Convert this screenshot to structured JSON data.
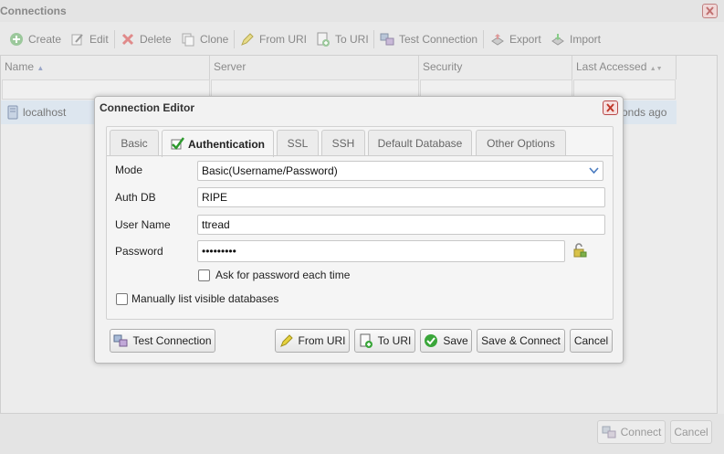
{
  "window": {
    "title": "Connections",
    "toolbar": {
      "create": "Create",
      "edit": "Edit",
      "delete": "Delete",
      "clone": "Clone",
      "from_uri": "From URI",
      "to_uri": "To URI",
      "test_connection": "Test Connection",
      "export": "Export",
      "import": "Import"
    },
    "columns": {
      "name": "Name",
      "server": "Server",
      "security": "Security",
      "last_accessed": "Last Accessed"
    },
    "rows": [
      {
        "name": "localhost",
        "last_accessed": "onds ago"
      }
    ],
    "footer": {
      "connect": "Connect",
      "cancel": "Cancel"
    }
  },
  "dialog": {
    "title": "Connection Editor",
    "tabs": {
      "basic": "Basic",
      "authentication": "Authentication",
      "ssl": "SSL",
      "ssh": "SSH",
      "default_database": "Default Database",
      "other_options": "Other Options"
    },
    "form": {
      "mode_label": "Mode",
      "mode_value": "Basic(Username/Password)",
      "auth_db_label": "Auth DB",
      "auth_db_value": "RIPE",
      "user_name_label": "User Name",
      "user_name_value": "ttread",
      "password_label": "Password",
      "password_value": "•••••••••",
      "ask_password": "Ask for password each time",
      "manual_list": "Manually list visible databases"
    },
    "buttons": {
      "test_connection": "Test Connection",
      "from_uri": "From URI",
      "to_uri": "To URI",
      "save": "Save",
      "save_connect": "Save & Connect",
      "cancel": "Cancel"
    }
  },
  "colors": {
    "accent_green": "#3aa63a",
    "close_red": "#c0392b",
    "selected_row": "#dde6ef"
  }
}
